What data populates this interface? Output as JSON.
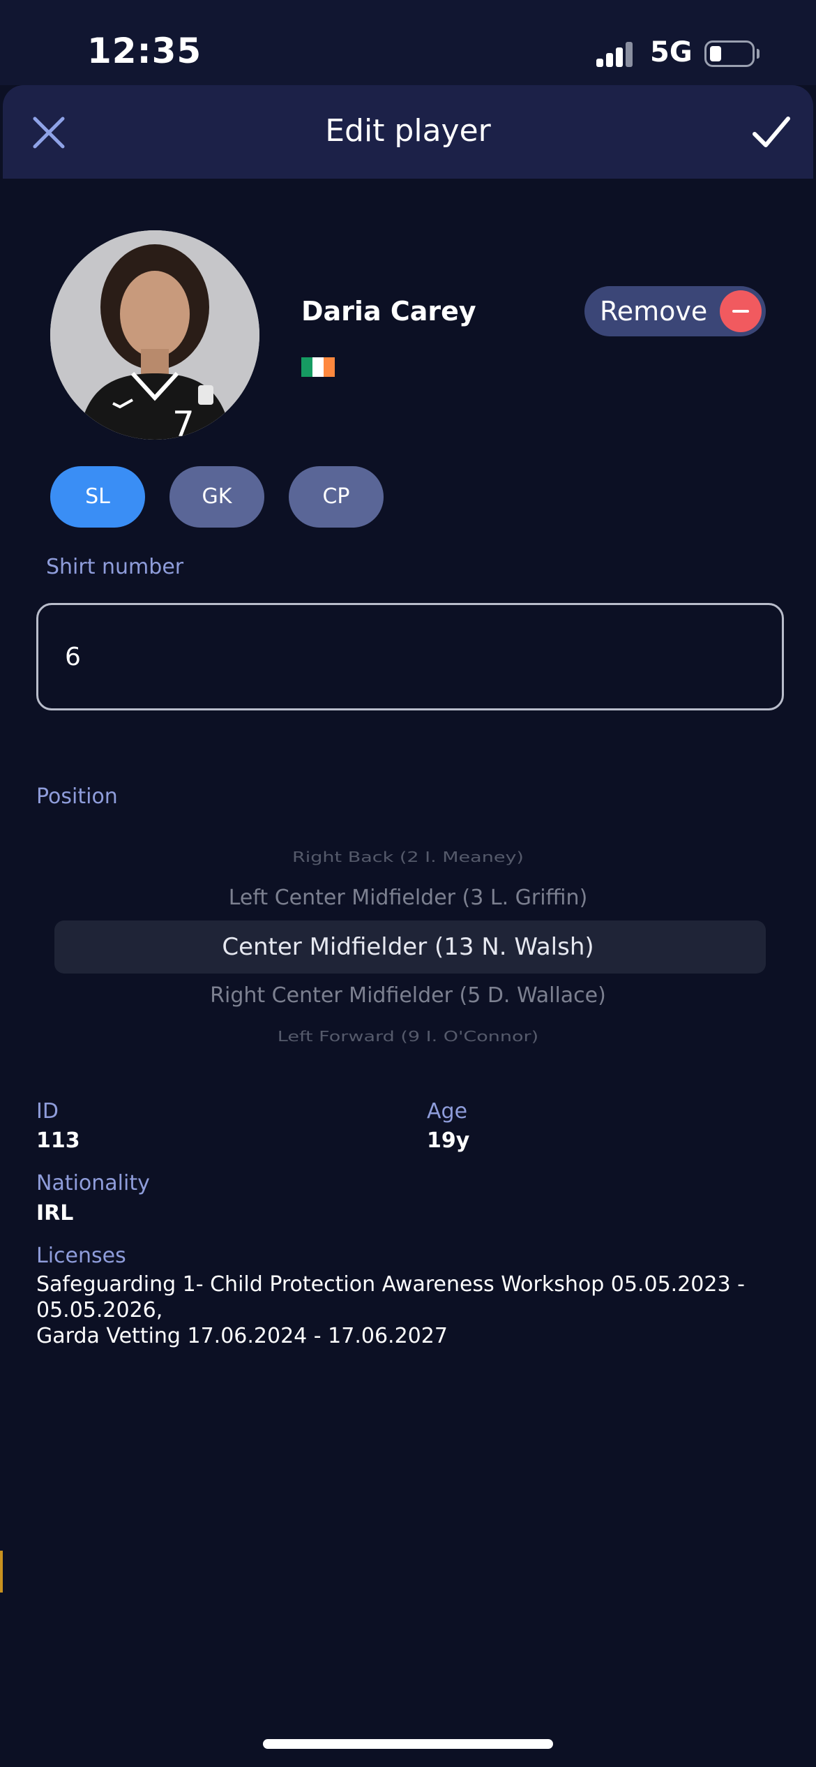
{
  "status_bar": {
    "time": "12:35",
    "network": "5G"
  },
  "header": {
    "title": "Edit player",
    "close_icon": "close-icon",
    "confirm_icon": "checkmark-icon"
  },
  "player": {
    "name": "Daria Carey",
    "flag": "ireland-flag",
    "flag_colors": [
      "#169b62",
      "#ffffff",
      "#ff883e"
    ]
  },
  "remove_button": {
    "label": "Remove",
    "icon": "minus-circle-icon",
    "color": "#f15a5f"
  },
  "roles": [
    {
      "label": "SL",
      "active": true
    },
    {
      "label": "GK",
      "active": false
    },
    {
      "label": "CP",
      "active": false
    }
  ],
  "shirt_number": {
    "label": "Shirt number",
    "value": "6"
  },
  "position": {
    "label": "Position",
    "options": [
      "Right Back (2 I. Meaney)",
      "Left Center Midfielder (3 L. Griffin)",
      "Center Midfielder (13 N. Walsh)",
      "Right Center Midfielder (5 D. Wallace)",
      "Left Forward (9 I. O'Connor)"
    ],
    "selected": "Center Midfielder (13 N. Walsh)"
  },
  "info": {
    "id_label": "ID",
    "id_value": "113",
    "age_label": "Age",
    "age_value": "19y",
    "nationality_label": "Nationality",
    "nationality_value": "IRL",
    "licenses_label": "Licenses",
    "licenses": [
      "Safeguarding 1- Child Protection Awareness Workshop 05.05.2023 - 05.05.2026,",
      "Garda Vetting 17.06.2024 - 17.06.2027"
    ]
  },
  "colors": {
    "background": "#0c1024",
    "header": "#1c2148",
    "accent": "#3a8ef5",
    "label": "#8f9ddb"
  }
}
